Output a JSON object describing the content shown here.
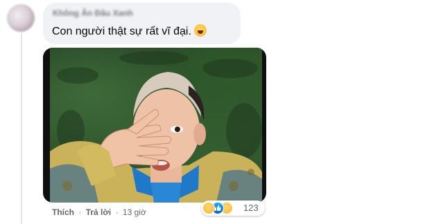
{
  "comment": {
    "author": "Không Ăn Đâu Xanh",
    "text": "Con người thật sự rất vĩ đại.",
    "inline_emoji": "grinning-face-with-sweat-emoji"
  },
  "actions": {
    "like_label": "Thích",
    "separator": "·",
    "reply_label": "Trả lời",
    "time": "13 giờ"
  },
  "reactions": {
    "icons": [
      "haha-reaction-icon",
      "like-reaction-icon",
      "sad-reaction-icon"
    ],
    "count": "123"
  },
  "colors": {
    "bubble": "#f0f2f5",
    "secondary_text": "#65676b",
    "primary_text": "#050505"
  }
}
